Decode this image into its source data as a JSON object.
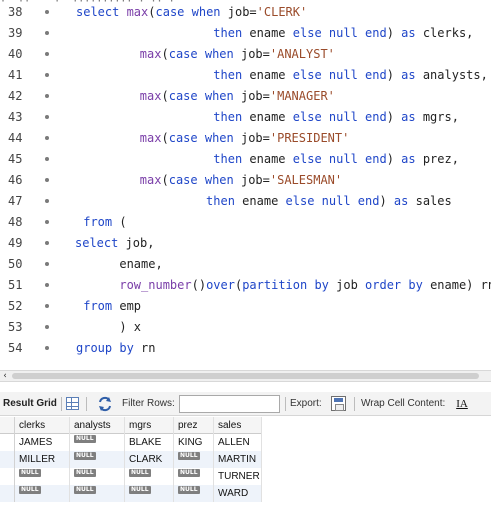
{
  "editor": {
    "partial_top_text": "·  ··    ·  ·········· · ·· ·",
    "lines": [
      {
        "num": "38",
        "tokens": [
          [
            "kw",
            "select "
          ],
          [
            "fn",
            "max"
          ],
          [
            "plain",
            "("
          ],
          [
            "kw",
            "case when "
          ],
          [
            "plain",
            "job="
          ],
          [
            "str",
            "'CLERK'"
          ]
        ]
      },
      {
        "num": "39",
        "tokens": [
          [
            "plain",
            "                   "
          ],
          [
            "kw",
            "then "
          ],
          [
            "plain",
            "ename "
          ],
          [
            "kw",
            "else null end"
          ],
          [
            "plain",
            ") "
          ],
          [
            "kw",
            "as "
          ],
          [
            "plain",
            "clerks,"
          ]
        ]
      },
      {
        "num": "40",
        "tokens": [
          [
            "plain",
            "        "
          ],
          [
            "fn",
            "max"
          ],
          [
            "plain",
            "("
          ],
          [
            "kw",
            "case when "
          ],
          [
            "plain",
            "job="
          ],
          [
            "str",
            "'ANALYST'"
          ]
        ]
      },
      {
        "num": "41",
        "tokens": [
          [
            "plain",
            "                   "
          ],
          [
            "kw",
            "then "
          ],
          [
            "plain",
            "ename "
          ],
          [
            "kw",
            "else null end"
          ],
          [
            "plain",
            ") "
          ],
          [
            "kw",
            "as "
          ],
          [
            "plain",
            "analysts,"
          ]
        ]
      },
      {
        "num": "42",
        "tokens": [
          [
            "plain",
            "        "
          ],
          [
            "fn",
            "max"
          ],
          [
            "plain",
            "("
          ],
          [
            "kw",
            "case when "
          ],
          [
            "plain",
            "job="
          ],
          [
            "str",
            "'MANAGER'"
          ]
        ]
      },
      {
        "num": "43",
        "tokens": [
          [
            "plain",
            "                   "
          ],
          [
            "kw",
            "then "
          ],
          [
            "plain",
            "ename "
          ],
          [
            "kw",
            "else null end"
          ],
          [
            "plain",
            ") "
          ],
          [
            "kw",
            "as "
          ],
          [
            "plain",
            "mgrs,"
          ]
        ]
      },
      {
        "num": "44",
        "tokens": [
          [
            "plain",
            "        "
          ],
          [
            "fn",
            "max"
          ],
          [
            "plain",
            "("
          ],
          [
            "kw",
            "case when "
          ],
          [
            "plain",
            "job="
          ],
          [
            "str",
            "'PRESIDENT'"
          ]
        ]
      },
      {
        "num": "45",
        "tokens": [
          [
            "plain",
            "                   "
          ],
          [
            "kw",
            "then "
          ],
          [
            "plain",
            "ename "
          ],
          [
            "kw",
            "else null end"
          ],
          [
            "plain",
            ") "
          ],
          [
            "kw",
            "as "
          ],
          [
            "plain",
            "prez,"
          ]
        ]
      },
      {
        "num": "46",
        "tokens": [
          [
            "plain",
            "        "
          ],
          [
            "fn",
            "max"
          ],
          [
            "plain",
            "("
          ],
          [
            "kw",
            "case when "
          ],
          [
            "plain",
            "job="
          ],
          [
            "str",
            "'SALESMAN'"
          ]
        ]
      },
      {
        "num": "47",
        "tokens": [
          [
            "plain",
            "                  "
          ],
          [
            "kw",
            "then "
          ],
          [
            "plain",
            "ename "
          ],
          [
            "kw",
            "else null end"
          ],
          [
            "plain",
            ") "
          ],
          [
            "kw",
            "as "
          ],
          [
            "plain",
            "sales"
          ]
        ]
      },
      {
        "num": "48",
        "tokens": [
          [
            "plain",
            " "
          ],
          [
            "kw",
            "from "
          ],
          [
            "plain",
            "("
          ]
        ]
      },
      {
        "num": "49",
        "tokens": [
          [
            "kw",
            "select "
          ],
          [
            "plain",
            "job,"
          ]
        ]
      },
      {
        "num": "50",
        "tokens": [
          [
            "plain",
            "      ename,"
          ]
        ]
      },
      {
        "num": "51",
        "tokens": [
          [
            "plain",
            "      "
          ],
          [
            "fn",
            "row_number"
          ],
          [
            "plain",
            "()"
          ],
          [
            "kw",
            "over"
          ],
          [
            "plain",
            "("
          ],
          [
            "kw",
            "partition by "
          ],
          [
            "plain",
            "job "
          ],
          [
            "kw",
            "order by "
          ],
          [
            "plain",
            "ename) rn"
          ]
        ]
      },
      {
        "num": "52",
        "tokens": [
          [
            "plain",
            " "
          ],
          [
            "kw",
            "from "
          ],
          [
            "plain",
            "emp"
          ]
        ]
      },
      {
        "num": "53",
        "tokens": [
          [
            "plain",
            "      ) x"
          ]
        ]
      },
      {
        "num": "54",
        "tokens": [
          [
            "kw",
            "group by "
          ],
          [
            "plain",
            "rn"
          ]
        ]
      }
    ],
    "line_offsets": [
      0,
      0,
      6,
      0,
      6,
      0,
      6,
      0,
      6,
      0,
      0,
      -1,
      0,
      0,
      0,
      0,
      0
    ]
  },
  "toolbar": {
    "result_grid_label": "Result Grid",
    "filter_rows_label": "Filter Rows:",
    "filter_rows_value": "",
    "export_label": "Export:",
    "wrap_cell_label": "Wrap Cell Content:",
    "wrap_icon_glyph": "IA"
  },
  "grid": {
    "columns": [
      "clerks",
      "analysts",
      "mgrs",
      "prez",
      "sales"
    ],
    "rows": [
      [
        "JAMES",
        "NULL",
        "BLAKE",
        "KING",
        "ALLEN"
      ],
      [
        "MILLER",
        "NULL",
        "CLARK",
        "NULL",
        "MARTIN"
      ],
      [
        "NULL",
        "NULL",
        "NULL",
        "NULL",
        "TURNER"
      ],
      [
        "NULL",
        "NULL",
        "NULL",
        "NULL",
        "WARD"
      ]
    ]
  },
  "colors": {
    "keyword": "#1f46c8",
    "function": "#7a3ea8",
    "string": "#9a4b2a",
    "null_badge": "#7f7f7f",
    "odd_row": "#eef3fa"
  },
  "icons": {
    "grid": "result-grid-icon",
    "refresh": "refresh-icon",
    "export": "export-icon",
    "wrap": "wrap-cell-icon"
  }
}
